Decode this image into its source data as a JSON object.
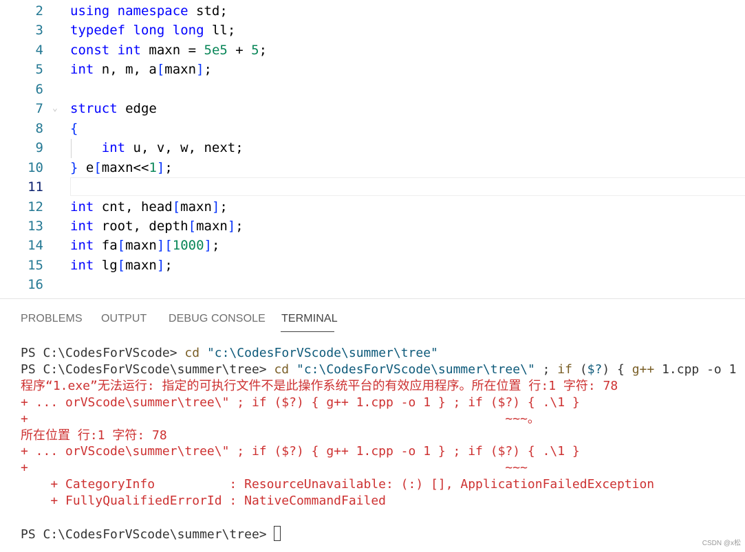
{
  "editor": {
    "active_line": "11",
    "lines": [
      {
        "n": "2",
        "tokens": [
          {
            "t": "using",
            "c": "kw"
          },
          {
            "t": " "
          },
          {
            "t": "namespace",
            "c": "kw"
          },
          {
            "t": " std;"
          }
        ]
      },
      {
        "n": "3",
        "tokens": [
          {
            "t": "typedef",
            "c": "kw"
          },
          {
            "t": " "
          },
          {
            "t": "long",
            "c": "kw"
          },
          {
            "t": " "
          },
          {
            "t": "long",
            "c": "kw"
          },
          {
            "t": " ll;"
          }
        ]
      },
      {
        "n": "4",
        "tokens": [
          {
            "t": "const",
            "c": "kw"
          },
          {
            "t": " "
          },
          {
            "t": "int",
            "c": "kw"
          },
          {
            "t": " maxn = "
          },
          {
            "t": "5e5",
            "c": "num"
          },
          {
            "t": " + "
          },
          {
            "t": "5",
            "c": "num"
          },
          {
            "t": ";"
          }
        ]
      },
      {
        "n": "5",
        "tokens": [
          {
            "t": "int",
            "c": "kw"
          },
          {
            "t": " n, m, a"
          },
          {
            "t": "[",
            "c": "br1"
          },
          {
            "t": "maxn"
          },
          {
            "t": "]",
            "c": "br1"
          },
          {
            "t": ";"
          }
        ]
      },
      {
        "n": "6",
        "tokens": []
      },
      {
        "n": "7",
        "fold": true,
        "tokens": [
          {
            "t": "struct",
            "c": "kw"
          },
          {
            "t": " edge"
          }
        ]
      },
      {
        "n": "8",
        "tokens": [
          {
            "t": "{",
            "c": "br1"
          }
        ]
      },
      {
        "n": "9",
        "tokens": [
          {
            "t": "    "
          },
          {
            "t": "int",
            "c": "kw"
          },
          {
            "t": " u, v, w, next;"
          }
        ]
      },
      {
        "n": "10",
        "tokens": [
          {
            "t": "}",
            "c": "br1"
          },
          {
            "t": " e"
          },
          {
            "t": "[",
            "c": "br1"
          },
          {
            "t": "maxn<<"
          },
          {
            "t": "1",
            "c": "num"
          },
          {
            "t": "]",
            "c": "br1"
          },
          {
            "t": ";"
          }
        ]
      },
      {
        "n": "11",
        "tokens": []
      },
      {
        "n": "12",
        "tokens": [
          {
            "t": "int",
            "c": "kw"
          },
          {
            "t": " cnt, head"
          },
          {
            "t": "[",
            "c": "br1"
          },
          {
            "t": "maxn"
          },
          {
            "t": "]",
            "c": "br1"
          },
          {
            "t": ";"
          }
        ]
      },
      {
        "n": "13",
        "tokens": [
          {
            "t": "int",
            "c": "kw"
          },
          {
            "t": " root, depth"
          },
          {
            "t": "[",
            "c": "br1"
          },
          {
            "t": "maxn"
          },
          {
            "t": "]",
            "c": "br1"
          },
          {
            "t": ";"
          }
        ]
      },
      {
        "n": "14",
        "tokens": [
          {
            "t": "int",
            "c": "kw"
          },
          {
            "t": " fa"
          },
          {
            "t": "[",
            "c": "br1"
          },
          {
            "t": "maxn"
          },
          {
            "t": "]",
            "c": "br1"
          },
          {
            "t": "[",
            "c": "br1"
          },
          {
            "t": "1000",
            "c": "num"
          },
          {
            "t": "]",
            "c": "br1"
          },
          {
            "t": ";"
          }
        ]
      },
      {
        "n": "15",
        "tokens": [
          {
            "t": "int",
            "c": "kw"
          },
          {
            "t": " lg"
          },
          {
            "t": "[",
            "c": "br1"
          },
          {
            "t": "maxn"
          },
          {
            "t": "]",
            "c": "br1"
          },
          {
            "t": ";"
          }
        ]
      },
      {
        "n": "16",
        "tokens": []
      }
    ]
  },
  "panel": {
    "tabs": [
      {
        "label": "PROBLEMS",
        "active": false
      },
      {
        "label": "OUTPUT",
        "active": false
      },
      {
        "label": "DEBUG CONSOLE",
        "active": false
      },
      {
        "label": "TERMINAL",
        "active": true
      }
    ]
  },
  "terminal": {
    "lines": [
      [
        {
          "t": "PS C:\\CodesForVScode> "
        },
        {
          "t": "cd",
          "c": "yel"
        },
        {
          "t": " "
        },
        {
          "t": "\"c:\\CodesForVScode\\summer\\tree\"",
          "c": "str"
        }
      ],
      [
        {
          "t": "PS C:\\CodesForVScode\\summer\\tree> "
        },
        {
          "t": "cd",
          "c": "yel"
        },
        {
          "t": " "
        },
        {
          "t": "\"c:\\CodesForVScode\\summer\\tree\\\"",
          "c": "str"
        },
        {
          "t": " ; "
        },
        {
          "t": "if",
          "c": "yel"
        },
        {
          "t": " ("
        },
        {
          "t": "$?",
          "c": "str"
        },
        {
          "t": ") { "
        },
        {
          "t": "g++",
          "c": "yel"
        },
        {
          "t": " 1.cpp -o 1"
        }
      ],
      [
        {
          "t": "程序“1.exe”无法运行: 指定的可执行文件不是此操作系统平台的有效应用程序。所在位置 行:1 字符: 78",
          "c": "err"
        }
      ],
      [
        {
          "t": "+ ... orVScode\\summer\\tree\\\" ; if ($?) { g++ 1.cpp -o 1 } ; if ($?) { .\\1 }",
          "c": "err"
        }
      ],
      [
        {
          "t": "+                                                                ~~~。",
          "c": "err"
        }
      ],
      [
        {
          "t": "所在位置 行:1 字符: 78",
          "c": "err"
        }
      ],
      [
        {
          "t": "+ ... orVScode\\summer\\tree\\\" ; if ($?) { g++ 1.cpp -o 1 } ; if ($?) { .\\1 }",
          "c": "err"
        }
      ],
      [
        {
          "t": "+                                                                ~~~",
          "c": "err"
        }
      ],
      [
        {
          "t": "    + CategoryInfo          : ResourceUnavailable: (:) [], ApplicationFailedException",
          "c": "err"
        }
      ],
      [
        {
          "t": "    + FullyQualifiedErrorId : NativeCommandFailed",
          "c": "err"
        }
      ],
      [],
      [
        {
          "t": "PS C:\\CodesForVScode\\summer\\tree> "
        }
      ]
    ]
  },
  "watermark": "CSDN @x松"
}
